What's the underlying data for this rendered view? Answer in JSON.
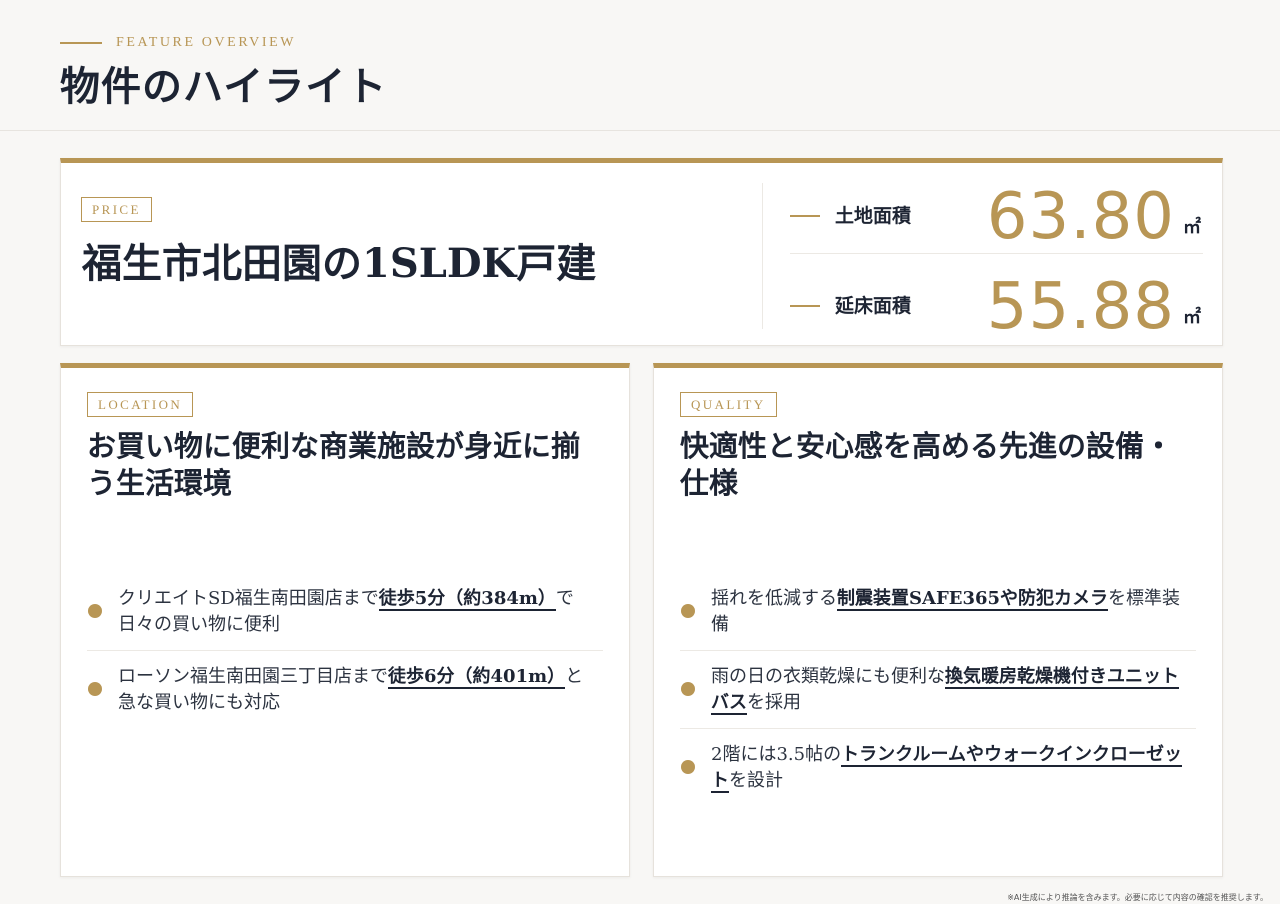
{
  "header": {
    "eyebrow": "FEATURE OVERVIEW",
    "title": "物件のハイライト"
  },
  "price_card": {
    "tag": "PRICE",
    "title": "福生市北田園の1SLDK戸建",
    "metrics": [
      {
        "label": "土地面積",
        "value": "63.80",
        "unit": "㎡"
      },
      {
        "label": "延床面積",
        "value": "55.88",
        "unit": "㎡"
      }
    ]
  },
  "location_card": {
    "tag": "LOCATION",
    "heading": "お買い物に便利な商業施設が身近に揃う生活環境",
    "bullets": [
      {
        "before": "クリエイトSD福生南田園店まで",
        "highlight": "徒歩5分（約384m）",
        "after": "で日々の買い物に便利"
      },
      {
        "before": "ローソン福生南田園三丁目店まで",
        "highlight": "徒歩6分（約401m）",
        "after": "と急な買い物にも対応"
      }
    ]
  },
  "quality_card": {
    "tag": "QUALITY",
    "heading": "快適性と安心感を高める先進の設備・仕様",
    "bullets": [
      {
        "before": "揺れを低減する",
        "highlight": "制震装置SAFE365や防犯カメラ",
        "after": "を標準装備"
      },
      {
        "before": "雨の日の衣類乾燥にも便利な",
        "highlight": "換気暖房乾燥機付きユニットバス",
        "after": "を採用"
      },
      {
        "before": "2階には3.5帖の",
        "highlight": "トランクルームやウォークインクローゼット",
        "after": "を設計"
      }
    ]
  },
  "footnote": "※AI生成により推論を含みます。必要に応じて内容の確認を推奨します。",
  "colors": {
    "accent_gold": "#b89655",
    "text_navy": "#1d2433",
    "background": "#f8f7f5"
  }
}
